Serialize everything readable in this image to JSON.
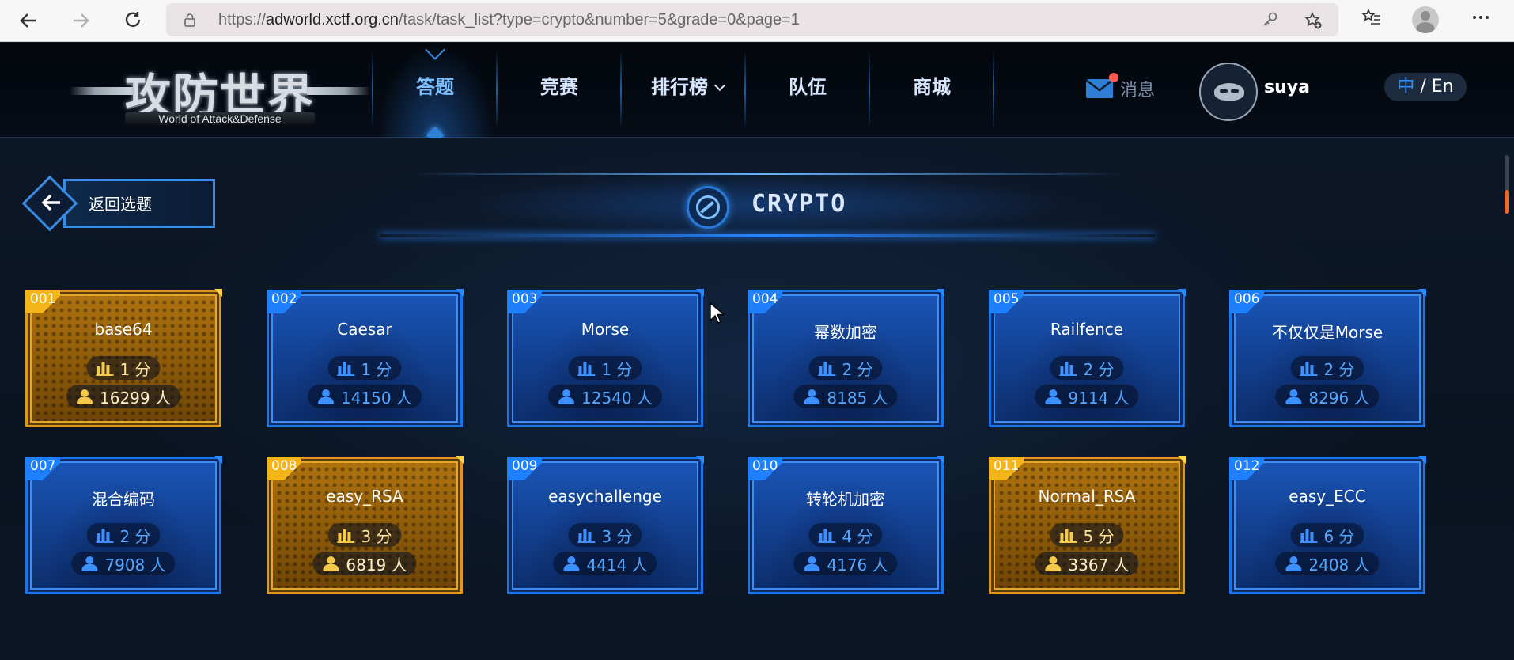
{
  "browser": {
    "url_prefix": "https://",
    "url_domain": "adworld.xctf.org.cn",
    "url_path": "/task/task_list?type=crypto&number=5&grade=0&page=1"
  },
  "site": {
    "logo_cn": "攻防世界",
    "logo_en": "World of Attack&Defense",
    "nav": [
      {
        "label": "答题",
        "active": true
      },
      {
        "label": "竞赛",
        "active": false
      },
      {
        "label": "排行榜",
        "active": false
      },
      {
        "label": "队伍",
        "active": false
      },
      {
        "label": "商城",
        "active": false
      }
    ],
    "messages_label": "消息",
    "username": "suya",
    "lang_zh": "中",
    "lang_sep": " / ",
    "lang_en": "En"
  },
  "page": {
    "back_label": "返回选题",
    "category_title": "CRYPTO"
  },
  "tasks": [
    {
      "num": "001",
      "title": "base64",
      "score": "1 分",
      "people": "16299 人",
      "style": "gold"
    },
    {
      "num": "002",
      "title": "Caesar",
      "score": "1 分",
      "people": "14150 人",
      "style": "blue"
    },
    {
      "num": "003",
      "title": "Morse",
      "score": "1 分",
      "people": "12540 人",
      "style": "blue"
    },
    {
      "num": "004",
      "title": "幂数加密",
      "score": "2 分",
      "people": "8185 人",
      "style": "blue"
    },
    {
      "num": "005",
      "title": "Railfence",
      "score": "2 分",
      "people": "9114 人",
      "style": "blue"
    },
    {
      "num": "006",
      "title": "不仅仅是Morse",
      "score": "2 分",
      "people": "8296 人",
      "style": "blue"
    },
    {
      "num": "007",
      "title": "混合编码",
      "score": "2 分",
      "people": "7908 人",
      "style": "blue"
    },
    {
      "num": "008",
      "title": "easy_RSA",
      "score": "3 分",
      "people": "6819 人",
      "style": "gold"
    },
    {
      "num": "009",
      "title": "easychallenge",
      "score": "3 分",
      "people": "4414 人",
      "style": "blue"
    },
    {
      "num": "010",
      "title": "转轮机加密",
      "score": "4 分",
      "people": "4176 人",
      "style": "blue"
    },
    {
      "num": "011",
      "title": "Normal_RSA",
      "score": "5 分",
      "people": "3367 人",
      "style": "gold"
    },
    {
      "num": "012",
      "title": "easy_ECC",
      "score": "6 分",
      "people": "2408 人",
      "style": "blue"
    }
  ],
  "colors": {
    "accent_blue": "#1e74e6",
    "gold": "#d99a1b",
    "badge_blue": "#1e7fff",
    "badge_gold": "#f4b51a"
  }
}
